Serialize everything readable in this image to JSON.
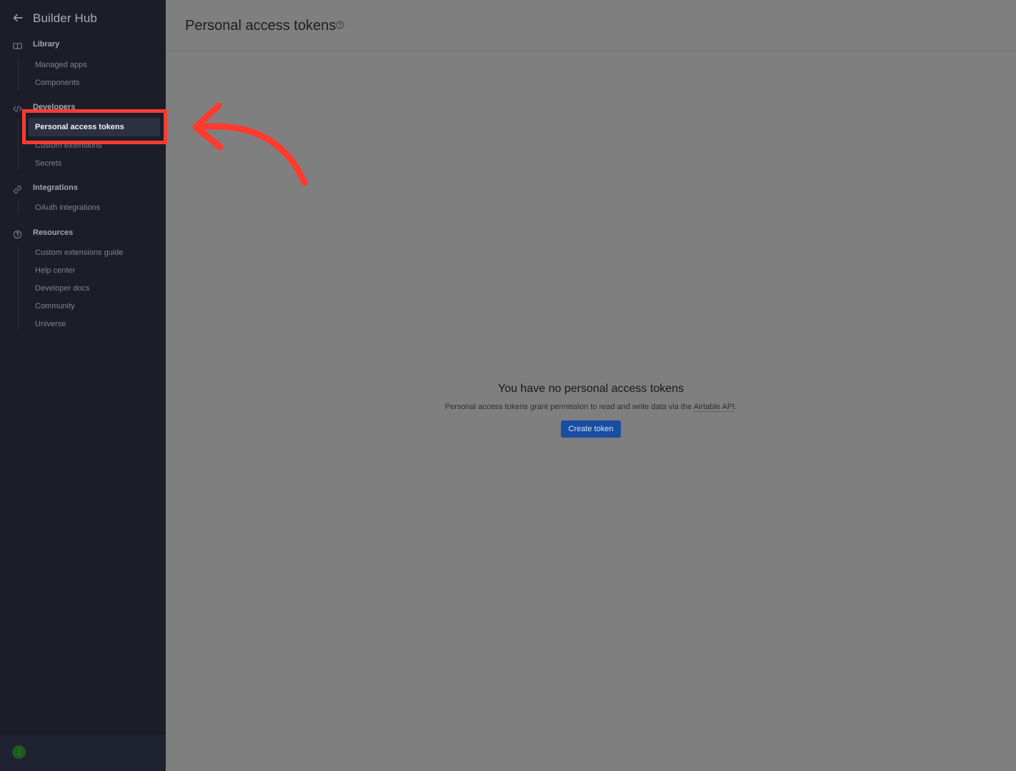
{
  "sidebar": {
    "title": "Builder Hub",
    "sections": [
      {
        "label": "Library",
        "icon": "book-icon",
        "items": [
          "Managed apps",
          "Components"
        ]
      },
      {
        "label": "Developers",
        "icon": "code-icon",
        "items": [
          "Personal access tokens",
          "Custom extensions",
          "Secrets"
        ]
      },
      {
        "label": "Integrations",
        "icon": "link-icon",
        "items": [
          "OAuth integrations"
        ]
      },
      {
        "label": "Resources",
        "icon": "help-circle-icon",
        "items": [
          "Custom extensions guide",
          "Help center",
          "Developer docs",
          "Community",
          "Universe"
        ]
      }
    ],
    "active_item": "Personal access tokens",
    "avatar_initial": "J"
  },
  "main": {
    "title": "Personal access tokens",
    "empty_title": "You have no personal access tokens",
    "empty_desc_prefix": "Personal access tokens grant permission to read and write data via the ",
    "empty_desc_link": "Airtable API",
    "empty_desc_suffix": ".",
    "create_button": "Create token"
  },
  "colors": {
    "annotation": "#ff3b30",
    "button": "#1a4ea3",
    "sidebar_bg": "#1b1e29"
  }
}
